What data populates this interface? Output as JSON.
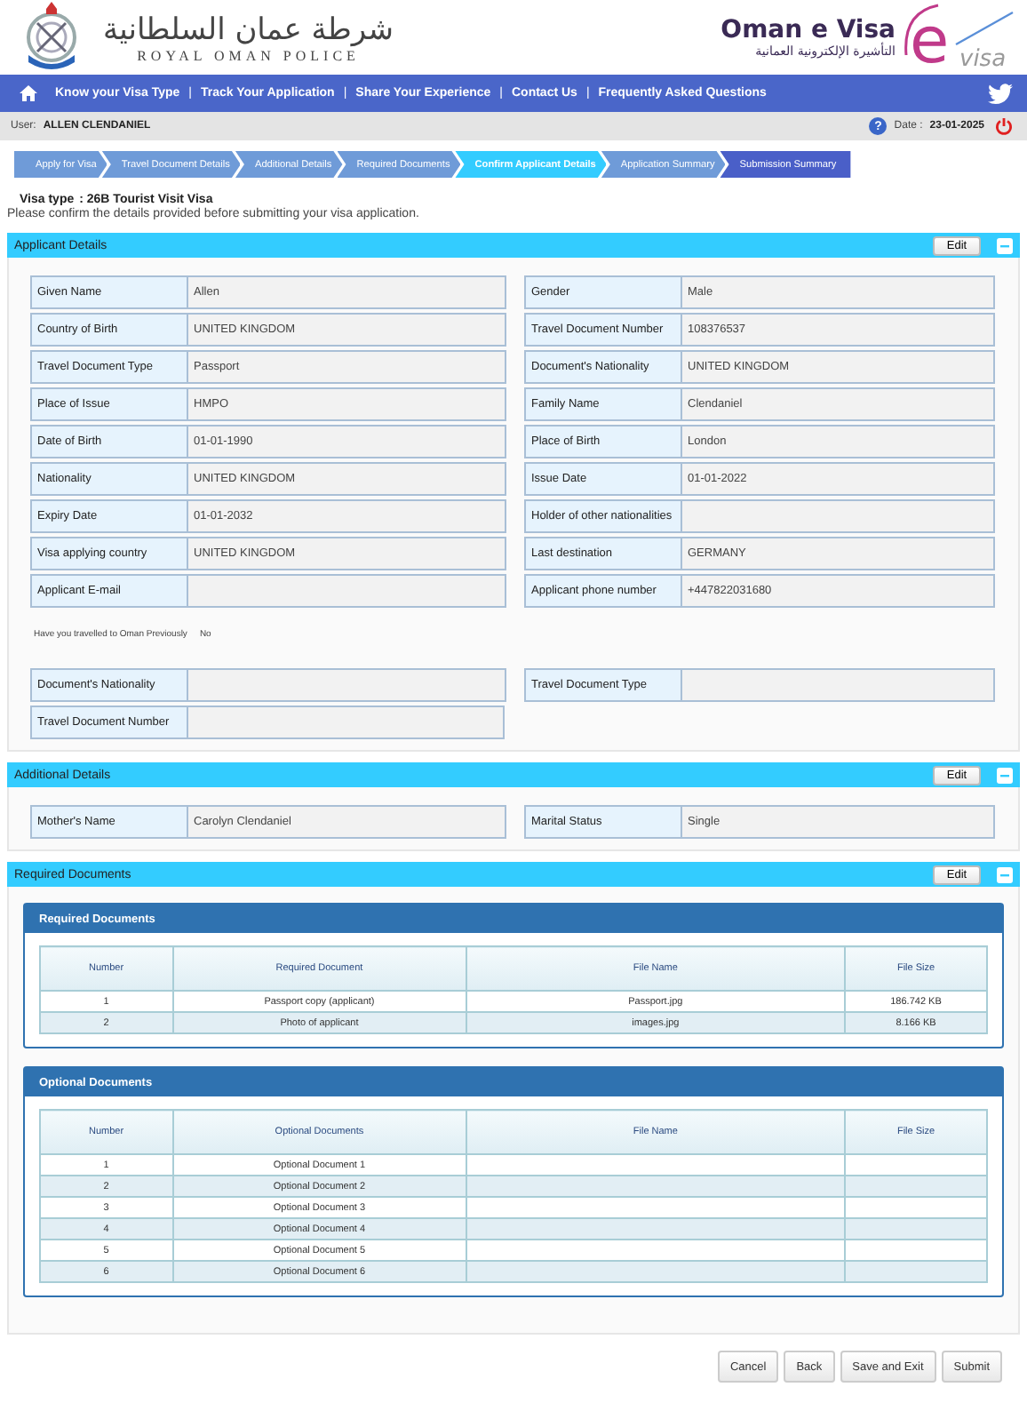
{
  "header": {
    "police_arabic": "شرطة عمان السلطانية",
    "police_english": "ROYAL OMAN POLICE",
    "evisa_title": "Oman e Visa",
    "evisa_arabic": "التأشيرة الإلكترونية العمانية",
    "logo_letter": "e",
    "logo_word": "visa"
  },
  "nav": {
    "items": [
      "Know your Visa Type",
      "Track Your Application",
      "Share Your Experience",
      "Contact Us",
      "Frequently Asked Questions"
    ],
    "separator": "|"
  },
  "user_bar": {
    "user_label": "User:",
    "user_name": "ALLEN  CLENDANIEL",
    "help": "?",
    "date_label": "Date :",
    "date": "23-01-2025"
  },
  "steps": [
    {
      "label": "Apply for Visa",
      "selected": false,
      "color": "#6f9bd8"
    },
    {
      "label": "Travel Document Details",
      "selected": false,
      "color": "#6f9bd8"
    },
    {
      "label": "Additional Details",
      "selected": false,
      "color": "#6f9bd8"
    },
    {
      "label": "Required Documents",
      "selected": false,
      "color": "#6f9bd8"
    },
    {
      "label": "Confirm Applicant Details",
      "selected": true,
      "color": "#33ccff"
    },
    {
      "label": "Application Summary",
      "selected": false,
      "color": "#6f9bd8"
    },
    {
      "label": "Submission Summary",
      "selected": false,
      "color": "#4a5fc8"
    }
  ],
  "visa_type": {
    "label": "Visa type",
    "value": ": 26B Tourist Visit Visa"
  },
  "instruction": "Please confirm the details provided before submitting your visa application.",
  "applicant_details": {
    "title": "Applicant Details",
    "edit_button": "Edit",
    "expanded": true,
    "rows_before": [
      {
        "left": {
          "label": "Given Name",
          "value": "Allen"
        },
        "right": {
          "label": "Gender",
          "value": "Male"
        }
      },
      {
        "left": {
          "label": "Country of Birth",
          "value": "UNITED KINGDOM"
        },
        "right": {
          "label": "Travel Document Number",
          "value": "108376537"
        }
      },
      {
        "left": {
          "label": "Travel Document Type",
          "value": "Passport"
        },
        "right": {
          "label": "Document's Nationality",
          "value": "UNITED KINGDOM"
        }
      },
      {
        "left": {
          "label": "Place of Issue",
          "value": "HMPO"
        },
        "right": {
          "label": "Family Name",
          "value": "Clendaniel"
        }
      },
      {
        "left": {
          "label": "Date of Birth",
          "value": "01-01-1990"
        },
        "right": {
          "label": "Place of Birth",
          "value": "London"
        }
      },
      {
        "left": {
          "label": "Nationality",
          "value": "UNITED KINGDOM"
        },
        "right": {
          "label": "Issue Date",
          "value": "01-01-2022"
        }
      },
      {
        "left": {
          "label": "Expiry Date",
          "value": "01-01-2032"
        },
        "right": {
          "label": "Holder of other nationalities"
        }
      },
      {
        "left": {
          "label": "Visa applying country",
          "value": "UNITED KINGDOM"
        },
        "right": {
          "label": "Last destination",
          "value": "GERMANY"
        }
      },
      {
        "left": {
          "label": "Applicant E-mail"
        },
        "right": {
          "label": "Applicant phone number",
          "value": "+447822031680"
        }
      }
    ],
    "travelled": {
      "question": "Have you travelled to Oman Previously",
      "answer": "No"
    },
    "rows_after": [
      {
        "left": {
          "label": "Document's Nationality"
        },
        "right": {
          "label": "Travel Document Type"
        }
      },
      {
        "left": {
          "label": "Travel Document Number"
        }
      }
    ]
  },
  "additional_details": {
    "title": "Additional Details",
    "edit_button": "Edit",
    "expanded": true,
    "rows": [
      {
        "left": {
          "label": "Mother's Name",
          "value": "Carolyn Clendaniel"
        },
        "right": {
          "label": "Marital Status",
          "value": "Single"
        }
      }
    ]
  },
  "required_documents": {
    "title": "Required Documents",
    "edit_button": "Edit",
    "expanded": true,
    "tables": [
      {
        "title": "Required Documents",
        "columns": [
          "Number",
          "Required Document",
          "File Name",
          "File Size"
        ],
        "rows": [
          [
            "1",
            "Passport copy (applicant)",
            "Passport.jpg",
            "186.742 KB"
          ],
          [
            "2",
            "Photo of applicant",
            "images.jpg",
            "8.166 KB"
          ]
        ]
      },
      {
        "title": "Optional Documents",
        "columns": [
          "Number",
          "Optional Documents",
          "File Name",
          "File Size"
        ],
        "rows": [
          [
            "1",
            "Optional Document 1"
          ],
          [
            "2",
            "Optional Document 2"
          ],
          [
            "3",
            "Optional Document 3"
          ],
          [
            "4",
            "Optional Document 4"
          ],
          [
            "5",
            "Optional Document 5"
          ],
          [
            "6",
            "Optional Document 6"
          ]
        ]
      }
    ]
  },
  "buttons": [
    "Cancel",
    "Back",
    "Save and Exit",
    "Submit"
  ]
}
